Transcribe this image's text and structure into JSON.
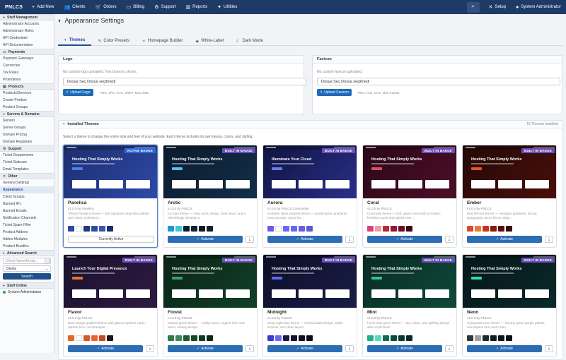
{
  "topbar": {
    "brand": "PNLCS",
    "nav": [
      {
        "icon": "plus-icon",
        "glyph": "+",
        "label": "Add New"
      },
      {
        "icon": "users-icon",
        "glyph": "👥",
        "label": "Clients"
      },
      {
        "icon": "cart-icon",
        "glyph": "🛒",
        "label": "Orders"
      },
      {
        "icon": "billing-icon",
        "glyph": "▭",
        "label": "Billing"
      },
      {
        "icon": "support-icon",
        "glyph": "⚙",
        "label": "Support"
      },
      {
        "icon": "reports-icon",
        "glyph": "▥",
        "label": "Reports"
      },
      {
        "icon": "utilities-icon",
        "glyph": "✦",
        "label": "Utilities"
      }
    ],
    "setup_label": "Setup",
    "user_label": "System Administrator"
  },
  "sidebar": {
    "sections": [
      {
        "title": "Staff Management",
        "icon": "users-icon",
        "items": [
          "Administrator Accounts",
          "Administrator Roles",
          "API Credentials",
          "API Documentation"
        ]
      },
      {
        "title": "Payments",
        "icon": "card-icon",
        "items": [
          "Payment Gateways",
          "Currencies",
          "Tax Rules",
          "Promotions"
        ]
      },
      {
        "title": "Products",
        "icon": "box-icon",
        "items": [
          "Products/Services",
          "Create Product",
          "Product Groups"
        ]
      },
      {
        "title": "Servers & Domains",
        "icon": "server-icon",
        "items": [
          "Servers",
          "Server Groups",
          "Domain Pricing",
          "Domain Registrars"
        ]
      },
      {
        "title": "Support",
        "icon": "support-icon",
        "items": [
          "Ticket Departments",
          "Ticket Statuses",
          "Email Templates"
        ]
      },
      {
        "title": "Other",
        "icon": "wrench-icon",
        "items": [
          "General Settings",
          "Appearance",
          "Client Groups",
          "Banned IPs",
          "Banned Emails",
          "Notification Channels",
          "Ticket Spam Filter",
          "Product Addons",
          "Addon Modules",
          "Product Bundles"
        ]
      }
    ],
    "active_item": "Appearance",
    "search": {
      "title": "Advanced Search",
      "placeholder": "Client Name/Email...",
      "select_value": "Clients",
      "button": "Search"
    },
    "online": {
      "title": "Staff Online",
      "user": "System Administrator"
    }
  },
  "page": {
    "title": "Appearance Settings",
    "tabs": [
      {
        "icon": "palette-icon",
        "glyph": "◐",
        "label": "Themes"
      },
      {
        "icon": "brush-icon",
        "glyph": "✎",
        "label": "Color Presets"
      },
      {
        "icon": "layout-icon",
        "glyph": "✧",
        "label": "Homepage Builder"
      },
      {
        "icon": "tag-icon",
        "glyph": "◈",
        "label": "White-Label"
      },
      {
        "icon": "moon-icon",
        "glyph": "☾",
        "label": "Dark Mode"
      }
    ],
    "active_tab": 0
  },
  "logo": {
    "title": "Logo",
    "note": "No custom logo uploaded. Text brand is shown.",
    "file_text": "Dosya Seç Dosya seçilmedi",
    "button": "Upload Logo",
    "hint": "PNG, JPG, SVG, WebP. Max 2MB."
  },
  "favicon": {
    "title": "Favicon",
    "note": "No custom favicon uploaded.",
    "file_text": "Dosya Seç Dosya seçilmedi",
    "button": "Upload Favicon",
    "hint": "PNG, ICO, SVG. Max 512KB."
  },
  "themes_panel": {
    "title": "Installed Themes",
    "count": "16 Themes installed",
    "subtitle": "Select a theme to change the entire look and feel of your website. Each theme includes its own layout, colors, and styling.",
    "activate_label": "Activate",
    "current_label": "Currently Active"
  },
  "themes": [
    {
      "name": "Panelica",
      "version": "v1.0.0 by Panelica",
      "desc": "Official Panelica theme — the signature deep blue palette with clean, profession…",
      "badge": "ACTIVE BADGE",
      "hero": "Hosting That Simply Works",
      "active": true,
      "bg": "#1d2e6e",
      "bg2": "#2e4aa8",
      "cta": "#4f7df2",
      "swatches": [
        "#2b4c9c",
        "#ffffff",
        "#1e3a80",
        "#2d4e9e",
        "#3a5aa8",
        "#1b2f66"
      ]
    },
    {
      "name": "Arctic",
      "version": "v1.0.0 by PNLCS",
      "desc": "Ice blue theme — crisp arctic design, clean lines, and a refreshingly minimal m…",
      "badge": "BUILT IN BADGE",
      "hero": "Hosting That Simply Works",
      "active": false,
      "bg": "#0b1a2e",
      "bg2": "#123048",
      "cta": "#4fc3e8",
      "swatches": [
        "#1a9ad0",
        "#3fc8d8",
        "#0e1d2e",
        "#112230",
        "#0f1a24",
        "#16202c"
      ]
    },
    {
      "name": "Aurora",
      "version": "v1.0.0 by PNLCS Community",
      "desc": "Northern lights inspired theme — purple-green gradients, neon accents, and a fut…",
      "badge": "BUILT IN BADGE",
      "hero": "Illuminate Your Cloud",
      "active": false,
      "bg": "#0e1440",
      "bg2": "#2c2f8a",
      "cta": "#6b7cf0",
      "swatches": [
        "#6a5ce8",
        "#ffffff",
        "#6a67f0",
        "#5a6ef0",
        "#6e5ae0",
        "#5d58d8"
      ]
    },
    {
      "name": "Coral",
      "version": "v1.0.0 by PNLCS",
      "desc": "Coral pink theme — soft, warm tones with a modern feminine touch and playful ener…",
      "badge": "BUILT IN BADGE",
      "hero": "Hosting That Simply Works",
      "active": false,
      "bg": "#2a0818",
      "bg2": "#4e0e28",
      "cta": "#e14b6a",
      "swatches": [
        "#d6487a",
        "#e8a0a0",
        "#b42a3c",
        "#8c1a34",
        "#6a0e24",
        "#3a0818"
      ]
    },
    {
      "name": "Ember",
      "version": "v1.0.0 by PNLCS",
      "desc": "Bold fire-red theme — energetic gradients, strong typography, and a fierce uniqu…",
      "badge": "BUILT IN BADGE",
      "hero": "Hosting That Simply Works",
      "active": false,
      "bg": "#240806",
      "bg2": "#4a100a",
      "cta": "#e8532a",
      "swatches": [
        "#d84a2a",
        "#e87a3a",
        "#c8321e",
        "#8a1a12",
        "#5e0e0a",
        "#3a0a06"
      ]
    },
    {
      "name": "Flavor",
      "version": "v1.0.0 by PNLCS",
      "desc": "Bold orange gradient theme with glassmorphism cards, particle hero, and transpar…",
      "badge": "BUILT IN BADGE",
      "hero": "Launch Your Digital Presence",
      "active": false,
      "bg": "#1a1230",
      "bg2": "#2e1a40",
      "cta": "#e8742a",
      "swatches": [
        "#e06a2a",
        "#ffffff",
        "#d85a2a",
        "#e8643a",
        "#c84a22",
        "#1a1420"
      ]
    },
    {
      "name": "Forest",
      "version": "v1.0.0 by PNLCS",
      "desc": "Natural green theme — earthy tones, organic feel, and warm, inviting design.",
      "badge": "BUILT IN BADGE",
      "hero": "Hosting That Simply Works",
      "active": false,
      "bg": "#0a2416",
      "bg2": "#124028",
      "cta": "#3aa06a",
      "swatches": [
        "#2e7a4e",
        "#3a8a5a",
        "#1e5a38",
        "#164a2c",
        "#0e3a22",
        "#0a2a18"
      ]
    },
    {
      "name": "Midnight",
      "version": "v1.0.0 by PNLCS",
      "desc": "Deep night blue theme — minimal dark design, subtle accents, and clean layout.",
      "badge": "BUILT IN BADGE",
      "hero": "Hosting That Simply Works",
      "active": false,
      "bg": "#0c0e26",
      "bg2": "#1a1e48",
      "cta": "#5a6af0",
      "swatches": [
        "#3a3ad0",
        "#6a6af0",
        "#1a1a40",
        "#12122e",
        "#0e0e22",
        "#0a0a1a"
      ]
    },
    {
      "name": "Mint",
      "version": "v1.0.0 by PNLCS",
      "desc": "Fresh mint green theme — airy, clean, and uplifting design with a soft touch.",
      "badge": "BUILT IN BADGE",
      "hero": "Hosting That Simply Works",
      "active": false,
      "bg": "#082a22",
      "bg2": "#0e4a3a",
      "cta": "#2ec4a0",
      "swatches": [
        "#1eb08a",
        "#5ad8c0",
        "#0e6a54",
        "#0a4a3a",
        "#083a2e",
        "#062a22"
      ]
    },
    {
      "name": "Neon",
      "version": "v1.0.0 by PNLCS",
      "desc": "Cyberpunk neon theme — electric green-purple palette, monospace font, and a futu…",
      "badge": "BUILT IN BADGE",
      "hero": "Hosting That Simply Works",
      "active": false,
      "bg": "#06161a",
      "bg2": "#0a2a2a",
      "cta": "#2ae0a0",
      "swatches": [
        "#2a3a3a",
        "#a0a0a0",
        "#1a2a2a",
        "#0e1e1e",
        "#0a1616",
        "#061010"
      ]
    }
  ]
}
